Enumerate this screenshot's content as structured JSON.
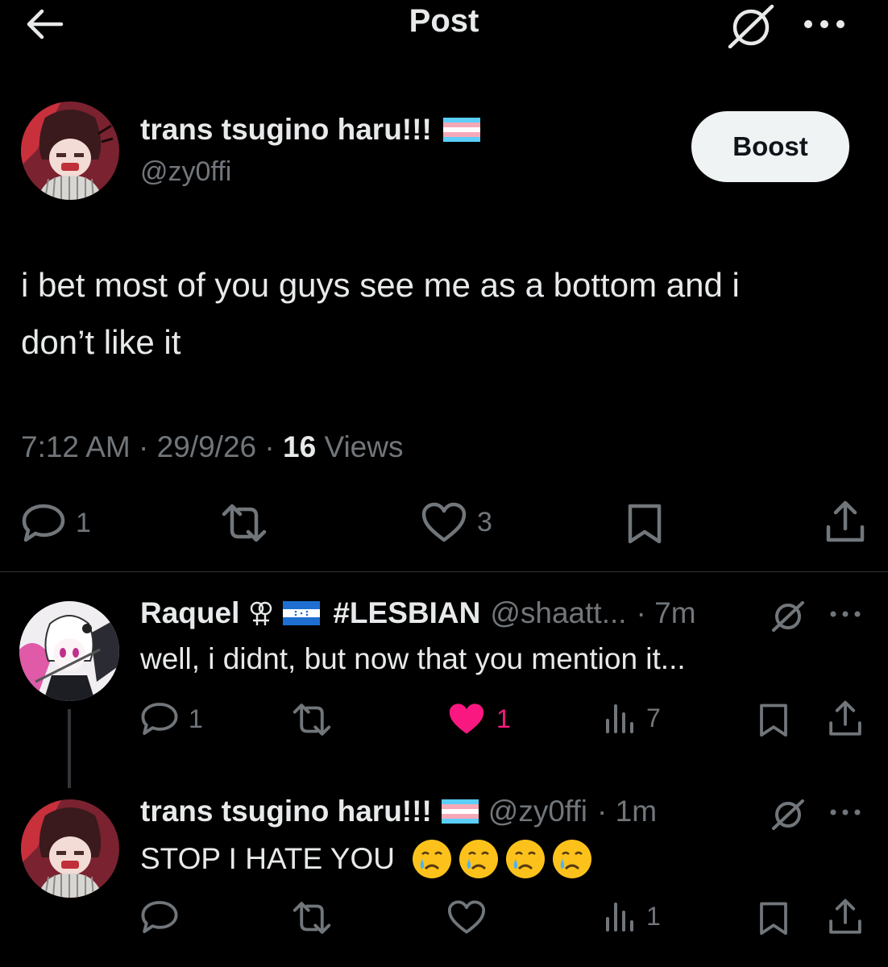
{
  "header": {
    "title": "Post"
  },
  "post": {
    "author": {
      "name": "trans tsugino haru!!!",
      "handle": "@zy0ffi"
    },
    "boost_label": "Boost",
    "text_line1": "i bet most of you guys see me as a bottom and i",
    "text_line2": "don’t like it",
    "time": "7:12 AM",
    "date": "29/9/26",
    "views_count": "16",
    "views_label": "Views",
    "replies": "1",
    "likes": "3"
  },
  "replies": [
    {
      "name": "Raquel",
      "tag": "#LESBIAN",
      "handle": "@shaatt...",
      "age": "· 7m",
      "text": "well, i didnt, but now that you mention it...",
      "replies": "1",
      "likes": "1",
      "views": "7",
      "liked": true
    },
    {
      "name": "trans tsugino haru!!!",
      "handle": "@zy0ffi",
      "age": "· 1m",
      "text": "STOP I HATE YOU",
      "views": "1"
    }
  ],
  "colors": {
    "like_active": "#f91880",
    "muted": "#71767b",
    "boost_bg": "#eff3f4"
  }
}
